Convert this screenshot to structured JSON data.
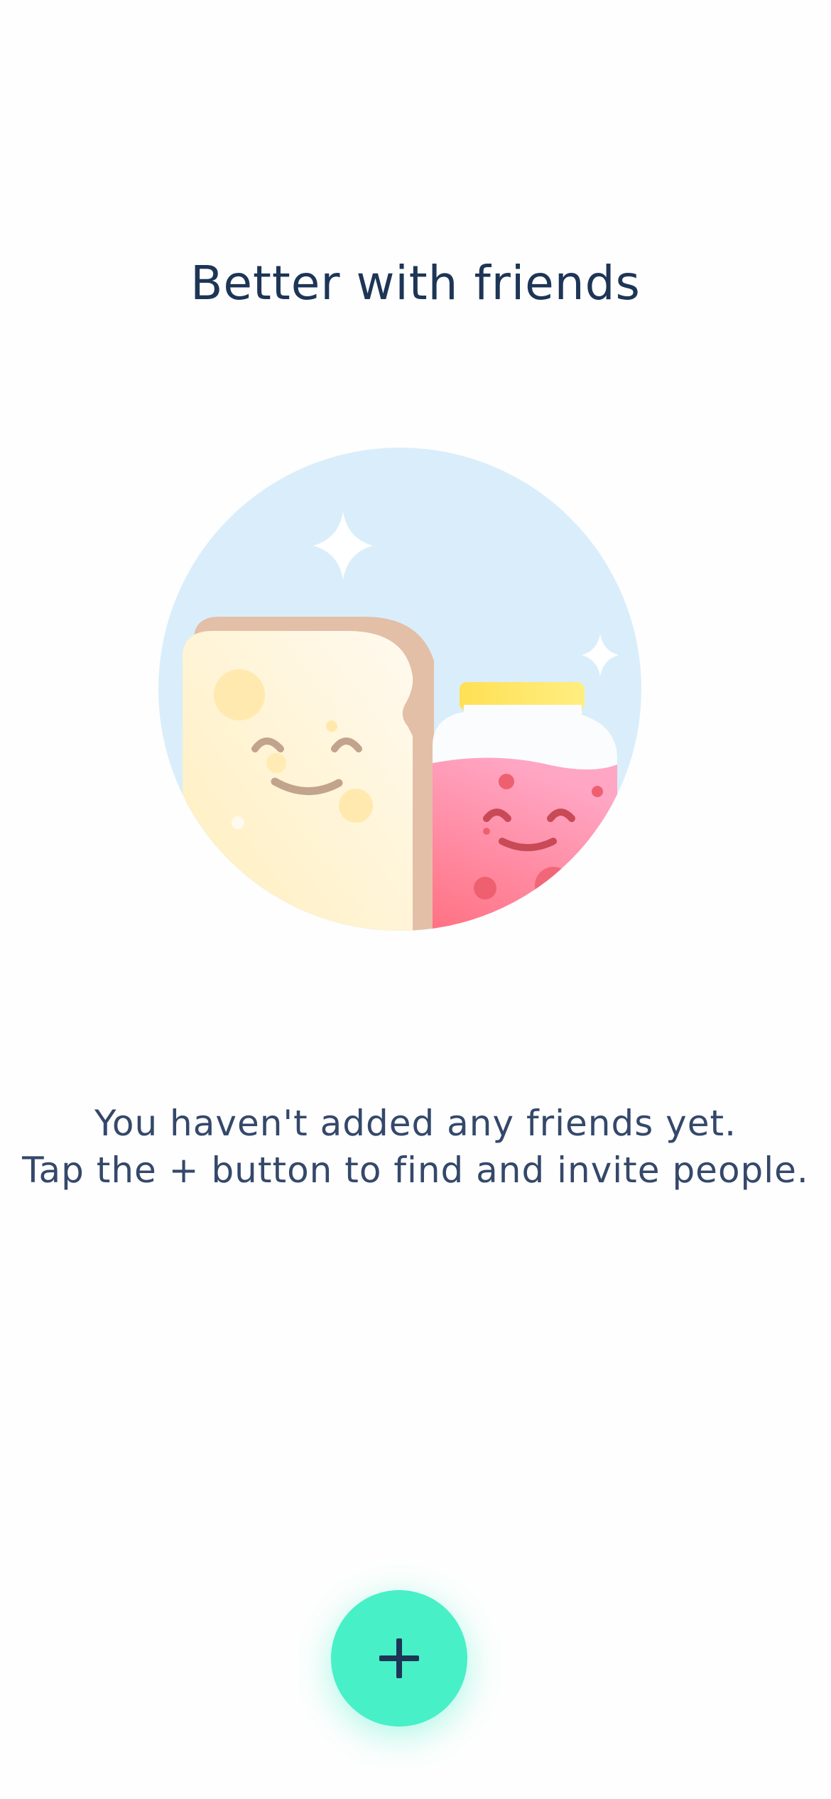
{
  "screen": {
    "title": "Better with friends",
    "message_line1": "You haven't added any friends yet.",
    "message_line2": "Tap the + button to find and invite people."
  },
  "fab": {
    "icon": "plus-icon",
    "color": "#48f0c7",
    "icon_color": "#1d3556"
  },
  "illustration": {
    "name": "bread-and-jam-friends",
    "colors": {
      "sky": "#d9eefa",
      "bread": "#fff5dc",
      "crust": "#e3bfa7",
      "jam": "#ff8ba8",
      "lid": "#ffe566"
    }
  }
}
